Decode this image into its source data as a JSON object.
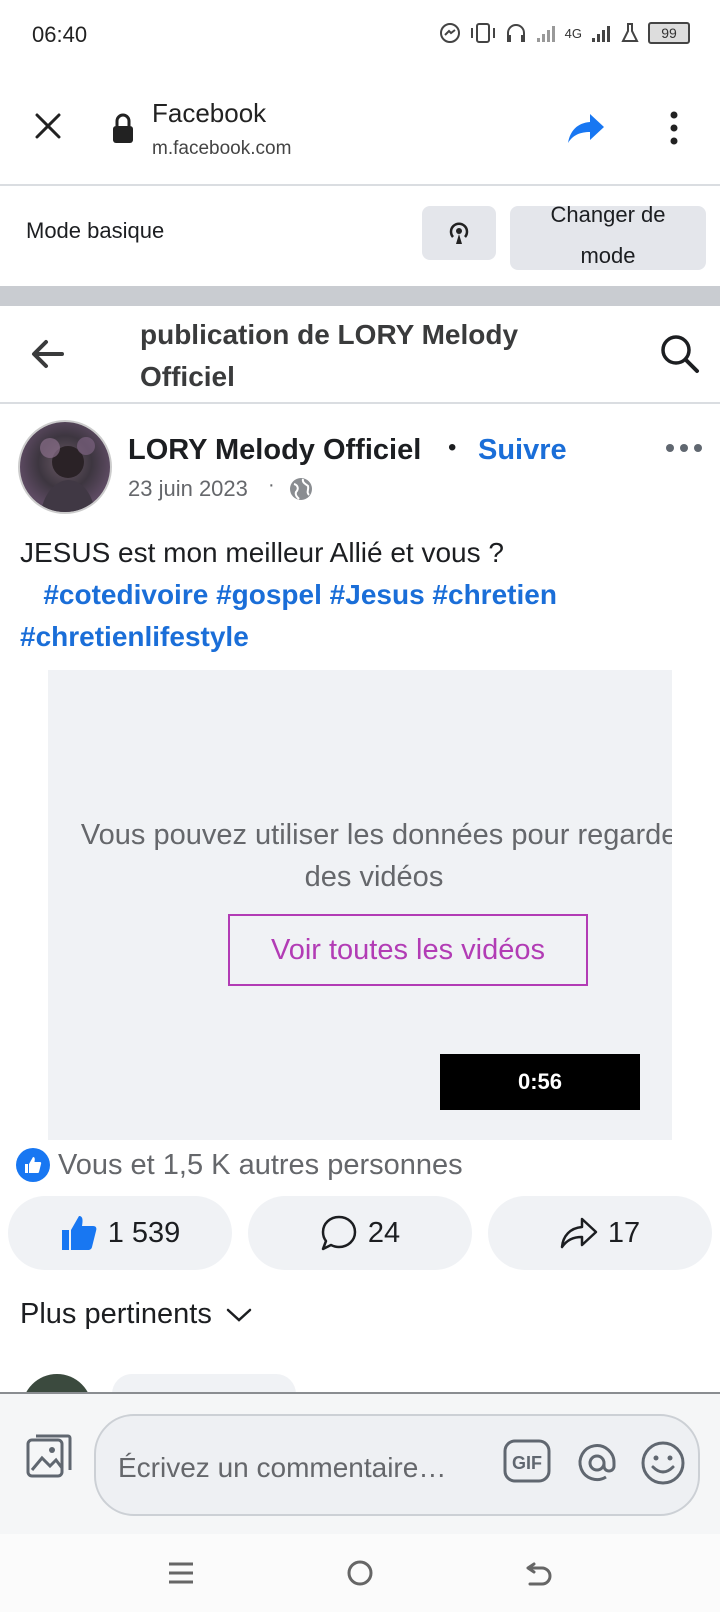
{
  "status_bar": {
    "time": "06:40",
    "network": "4G",
    "battery": "99"
  },
  "browser": {
    "title": "Facebook",
    "url": "m.facebook.com"
  },
  "mode_bar": {
    "basic_label": "Mode basique",
    "change_label_1": "Changer de",
    "change_label_2": "mode"
  },
  "header": {
    "title": "publication de LORY Melody Officiel"
  },
  "post": {
    "author": "LORY Melody Officiel",
    "separator": "•",
    "follow_label": "Suivre",
    "date": "23 juin 2023",
    "date_separator": "·",
    "text": "JESUS est mon meilleur Allié et vous ?",
    "hashtags": [
      "#cotedivoire",
      "#gospel",
      "#Jesus",
      "#chretien",
      "#chretienlifestyle"
    ]
  },
  "video": {
    "message_line1": "Vous pouvez utiliser les données pour regarder",
    "message_line2": "des vidéos",
    "watch_all_label": "Voir toutes les vidéos",
    "duration": "0:56"
  },
  "reactions": {
    "summary": "Vous et 1,5 K autres personnes"
  },
  "actions": {
    "likes": "1 539",
    "comments": "24",
    "shares": "17"
  },
  "comments": {
    "sort_label": "Plus pertinents"
  },
  "composer": {
    "placeholder": "Écrivez un commentaire…"
  },
  "colors": {
    "link": "#1a6ed8",
    "accent_video": "#b23cb5",
    "facebook_blue": "#1877f2"
  }
}
